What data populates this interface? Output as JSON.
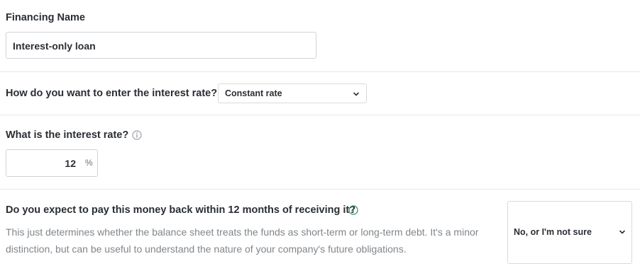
{
  "financing": {
    "label": "Financing Name",
    "value": "Interest-only loan"
  },
  "rate_entry": {
    "question": "How do you want to enter the interest rate?",
    "selected": "Constant rate"
  },
  "interest_rate": {
    "question": "What is the interest rate?",
    "value": "12",
    "unit": "%"
  },
  "repayment": {
    "question": "Do you expect to pay this money back within 12 months of receiving it?",
    "description": "This just determines whether the balance sheet treats the funds as short-term or long-term debt. It's a minor distinction, but can be useful to understand the nature of your company's future obligations.",
    "selected": "No, or I'm not sure"
  },
  "colors": {
    "info_green": "#2e8b57",
    "info_gray": "#9aa0a6",
    "divider": "#e6e8ea"
  }
}
